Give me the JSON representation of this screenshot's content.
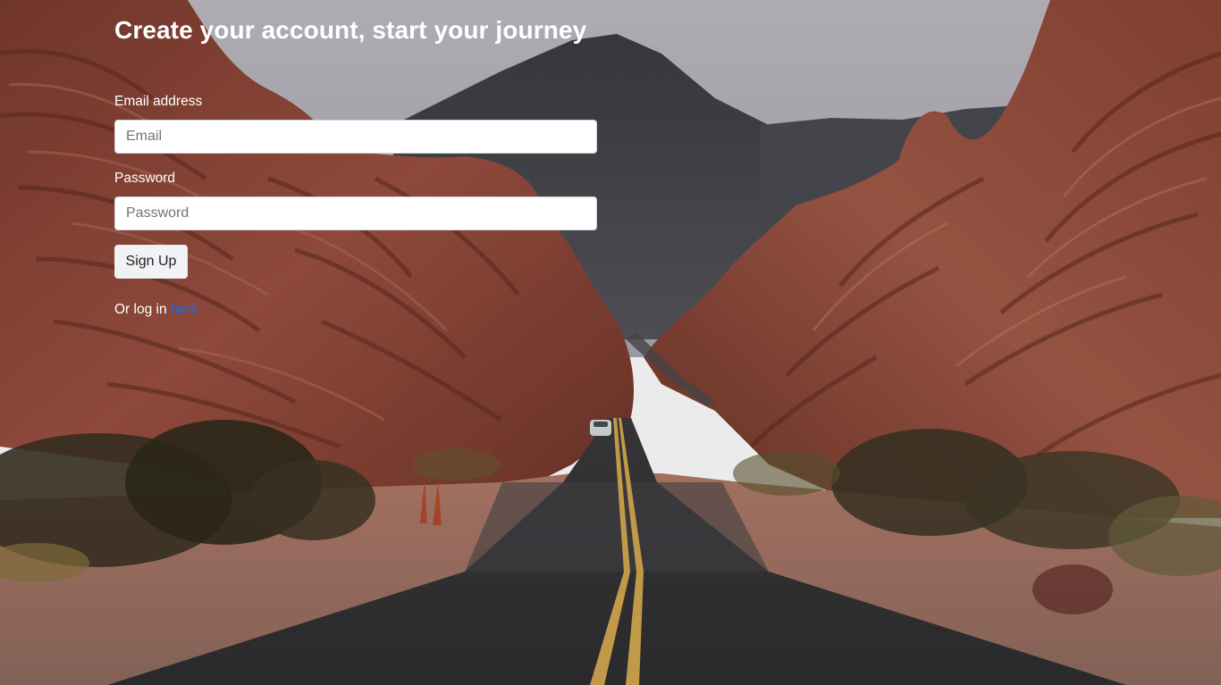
{
  "page": {
    "title": "Create your account, start your journey"
  },
  "form": {
    "email_label": "Email address",
    "email_placeholder": "Email",
    "email_value": "",
    "password_label": "Password",
    "password_placeholder": "Password",
    "password_value": "",
    "submit_label": "Sign Up"
  },
  "login": {
    "prefix": "Or log in ",
    "link_text": "here"
  },
  "colors": {
    "sky": "#b8b6bc",
    "rock": "#8a4638",
    "road": "#38383a",
    "link": "#0d6efd",
    "button_bg": "#f1f2f3"
  }
}
